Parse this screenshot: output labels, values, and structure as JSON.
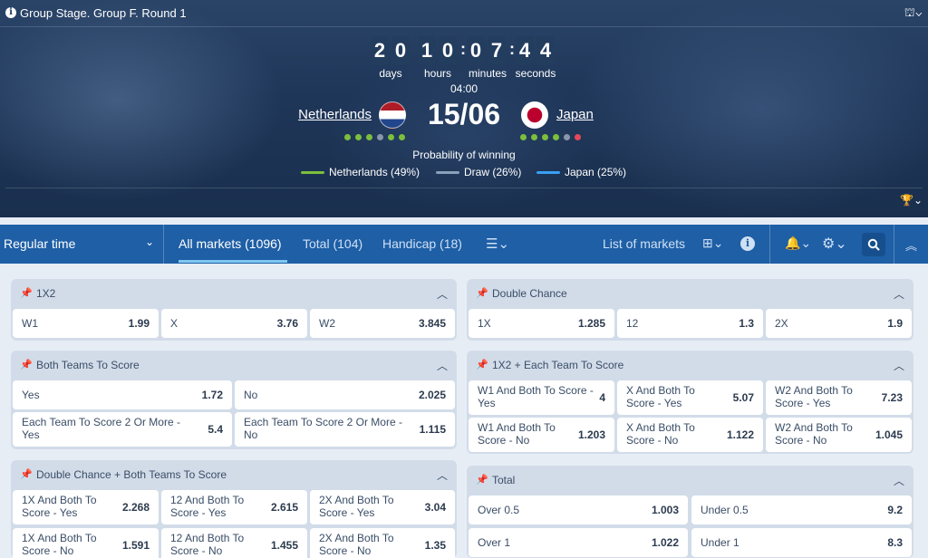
{
  "header": {
    "stage_title": "Group Stage. Group F. Round 1",
    "countdown": {
      "days": [
        "2",
        "0"
      ],
      "hours": [
        "1",
        "0"
      ],
      "minutes": [
        "0",
        "7"
      ],
      "seconds": [
        "4",
        "4"
      ],
      "labels": {
        "days": "days",
        "hours": "hours",
        "minutes": "minutes",
        "seconds": "seconds"
      }
    },
    "kickoff_time": "04:00",
    "match_date": "15/06",
    "home_team": "Netherlands",
    "away_team": "Japan",
    "home_form": [
      "#7cbf3c",
      "#7cbf3c",
      "#7cbf3c",
      "#8a97ab",
      "#7cbf3c",
      "#7cbf3c"
    ],
    "away_form": [
      "#7cbf3c",
      "#7cbf3c",
      "#7cbf3c",
      "#7cbf3c",
      "#8a97ab",
      "#e5485a"
    ],
    "probability_title": "Probability of winning",
    "probability": [
      {
        "label": "Netherlands (49%)",
        "color": "#7cbf3c"
      },
      {
        "label": "Draw (26%)",
        "color": "#8aa0bb"
      },
      {
        "label": "Japan (25%)",
        "color": "#3a9ff2"
      }
    ]
  },
  "market_bar": {
    "period": "Regular time",
    "tabs": [
      {
        "label": "All markets (1096)",
        "active": true
      },
      {
        "label": "Total (104)",
        "active": false
      },
      {
        "label": "Handicap (18)",
        "active": false
      }
    ],
    "list_of_markets": "List of markets"
  },
  "markets": {
    "m1x2": {
      "title": "1X2",
      "odds": [
        {
          "label": "W1",
          "value": "1.99"
        },
        {
          "label": "X",
          "value": "3.76"
        },
        {
          "label": "W2",
          "value": "3.845"
        }
      ]
    },
    "double_chance": {
      "title": "Double Chance",
      "odds": [
        {
          "label": "1X",
          "value": "1.285"
        },
        {
          "label": "12",
          "value": "1.3"
        },
        {
          "label": "2X",
          "value": "1.9"
        }
      ]
    },
    "btts": {
      "title": "Both Teams To Score",
      "odds": [
        {
          "label": "Yes",
          "value": "1.72"
        },
        {
          "label": "No",
          "value": "2.025"
        },
        {
          "label": "Each Team To Score 2 Or More - Yes",
          "value": "5.4"
        },
        {
          "label": "Each Team To Score 2 Or More - No",
          "value": "1.115"
        }
      ]
    },
    "each_team": {
      "title": "1X2 + Each Team To Score",
      "odds": [
        {
          "label": "W1 And Both To Score - Yes",
          "value": "4"
        },
        {
          "label": "X And Both To Score - Yes",
          "value": "5.07"
        },
        {
          "label": "W2 And Both To Score - Yes",
          "value": "7.23"
        },
        {
          "label": "W1 And Both To Score - No",
          "value": "1.203"
        },
        {
          "label": "X And Both To Score - No",
          "value": "1.122"
        },
        {
          "label": "W2 And Both To Score - No",
          "value": "1.045"
        }
      ]
    },
    "dc_btts": {
      "title": "Double Chance + Both Teams To Score",
      "odds": [
        {
          "label": "1X And Both To Score - Yes",
          "value": "2.268"
        },
        {
          "label": "12 And Both To Score - Yes",
          "value": "2.615"
        },
        {
          "label": "2X And Both To Score - Yes",
          "value": "3.04"
        },
        {
          "label": "1X And Both To Score - No",
          "value": "1.591"
        },
        {
          "label": "12 And Both To Score - No",
          "value": "1.455"
        },
        {
          "label": "2X And Both To Score - No",
          "value": "1.35"
        }
      ]
    },
    "total": {
      "title": "Total",
      "odds": [
        {
          "label": "Over 0.5",
          "value": "1.003"
        },
        {
          "label": "Under 0.5",
          "value": "9.2"
        },
        {
          "label": "Over 1",
          "value": "1.022"
        },
        {
          "label": "Under 1",
          "value": "8.3"
        }
      ]
    }
  }
}
